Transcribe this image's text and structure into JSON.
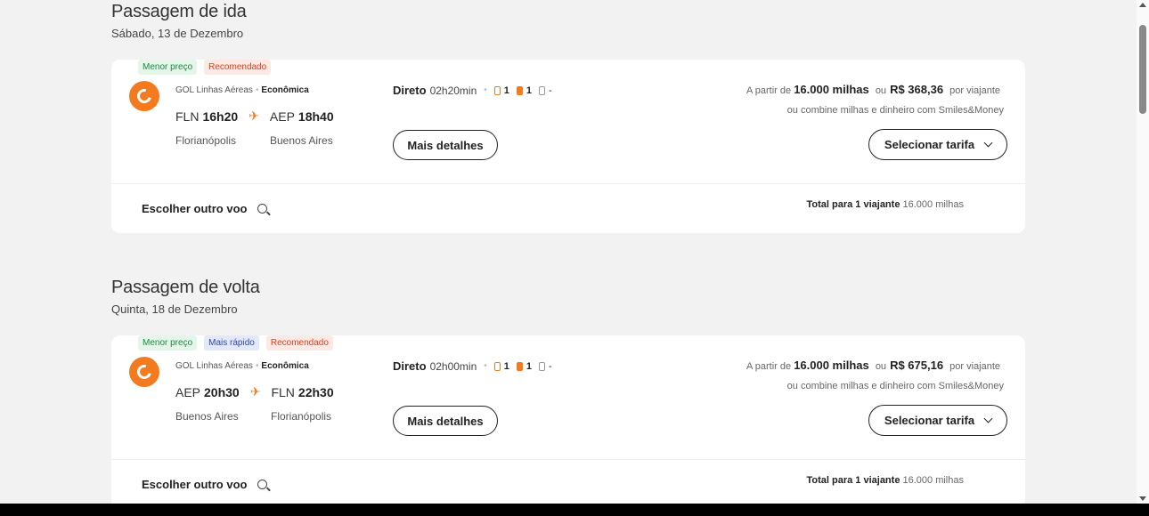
{
  "outbound": {
    "title": "Passagem de ida",
    "date": "Sábado, 13 de Dezembro",
    "badges": [
      "Menor preço",
      "Recomendado"
    ],
    "airline": "GOL Linhas Aéreas",
    "cabin": "Econômica",
    "origin_code": "FLN",
    "origin_time": "16h20",
    "dest_code": "AEP",
    "dest_time": "18h40",
    "origin_city": "Florianópolis",
    "dest_city": "Buenos Aires",
    "stops": "Direto",
    "duration": "02h20min",
    "bag_personal": "1",
    "bag_carry": "1",
    "bag_checked": "-",
    "details_label": "Mais detalhes",
    "price_prefix": "A partir de",
    "miles": "16.000 milhas",
    "or": "ou",
    "money": "R$ 368,36",
    "per": "por viajante",
    "combine": "ou combine milhas e dinheiro com Smiles&Money",
    "select_label": "Selecionar tarifa",
    "choose_label": "Escolher outro voo",
    "total_label": "Total para 1 viajante",
    "total_value": "16.000 milhas"
  },
  "inbound": {
    "title": "Passagem de volta",
    "date": "Quinta, 18 de Dezembro",
    "badges": [
      "Menor preço",
      "Mais rápido",
      "Recomendado"
    ],
    "airline": "GOL Linhas Aéreas",
    "cabin": "Econômica",
    "origin_code": "AEP",
    "origin_time": "20h30",
    "dest_code": "FLN",
    "dest_time": "22h30",
    "origin_city": "Buenos Aires",
    "dest_city": "Florianópolis",
    "stops": "Direto",
    "duration": "02h00min",
    "bag_personal": "1",
    "bag_carry": "1",
    "bag_checked": "-",
    "details_label": "Mais detalhes",
    "price_prefix": "A partir de",
    "miles": "16.000 milhas",
    "or": "ou",
    "money": "R$ 675,16",
    "per": "por viajante",
    "combine": "ou combine milhas e dinheiro com Smiles&Money",
    "select_label": "Selecionar tarifa",
    "choose_label": "Escolher outro voo",
    "total_label": "Total para 1 viajante",
    "total_value": "16.000 milhas"
  },
  "colors": {
    "brand": "#f47a20",
    "badge_green": "#1c8a3f",
    "badge_blue": "#2a48b8",
    "badge_red": "#e0401e"
  },
  "icons": [
    "gol-logo-icon",
    "plane-icon",
    "personal-bag-icon",
    "carry-on-bag-icon",
    "checked-bag-icon",
    "search-icon",
    "chevron-down-icon"
  ]
}
